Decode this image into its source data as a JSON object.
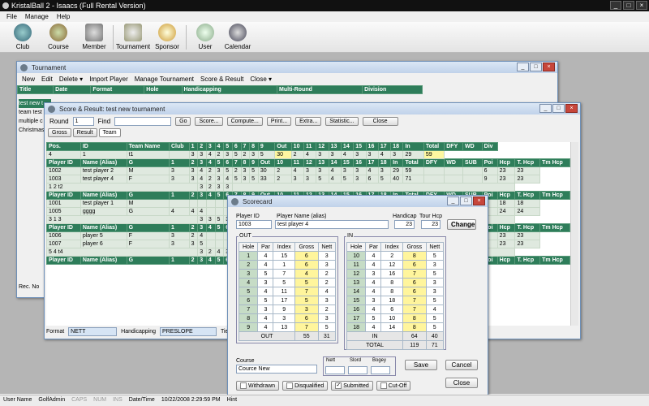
{
  "app": {
    "title": "KristalBall 2 - Isaacs (Full Rental Version)"
  },
  "menu": [
    "File",
    "Manage",
    "Help"
  ],
  "toolbar": [
    "Club",
    "Course",
    "Member",
    "Tournament",
    "Sponsor",
    "User",
    "Calendar"
  ],
  "tourn": {
    "title": "Tournament",
    "tools": [
      "New",
      "Edit",
      "Delete ▾",
      "Import Player",
      "Manage Tournament",
      "Score & Result",
      "Close ▾"
    ],
    "headers": [
      "Title",
      "Date",
      "Format",
      "Hole",
      "Handicapping",
      "Multi-Round",
      "Division"
    ],
    "rows": [
      "test new t",
      "team test",
      "multiple c",
      "Christmas"
    ],
    "rec": "Rec. No"
  },
  "sr": {
    "title": "Score & Result: test new tournament",
    "round_label": "Round",
    "round_val": "1",
    "find_label": "Find",
    "buttons": [
      "Go",
      "Score...",
      "Compute...",
      "Print...",
      "Extra...",
      "Statistic...",
      "Close"
    ],
    "tabs": [
      "Gross",
      "Result",
      "Team"
    ],
    "team_headers": [
      "Pos.",
      "ID",
      "Team Name",
      "Club",
      "1",
      "2",
      "3",
      "4",
      "5",
      "6",
      "7",
      "8",
      "9",
      "Out",
      "10",
      "11",
      "12",
      "13",
      "14",
      "15",
      "16",
      "17",
      "18",
      "In",
      "Total",
      "DFY",
      "WD",
      "Div"
    ],
    "team1": [
      "4",
      "1",
      "t1",
      "",
      "3",
      "3",
      "4",
      "2",
      "3",
      "5",
      "2",
      "3",
      "5",
      "30",
      "2",
      "4",
      "3",
      "3",
      "4",
      "3",
      "3",
      "4",
      "3",
      "29",
      "59"
    ],
    "ph": [
      "Player ID",
      "Name (Alias)",
      "G",
      "1",
      "2",
      "3",
      "4",
      "5",
      "6",
      "7",
      "8",
      "9",
      "Out",
      "10",
      "11",
      "12",
      "13",
      "14",
      "15",
      "16",
      "17",
      "18",
      "In",
      "Total",
      "DFY",
      "WD",
      "SUB",
      "Poi",
      "Hcp",
      "T. Hcp",
      "Tm Hcp"
    ],
    "p1": [
      "1002",
      "test player 2",
      "M",
      "3",
      "3",
      "4",
      "2",
      "3",
      "5",
      "2",
      "3",
      "5",
      "30",
      "2",
      "4",
      "3",
      "3",
      "4",
      "3",
      "3",
      "4",
      "3",
      "29",
      "59",
      "",
      "",
      "",
      "6",
      "23",
      "23"
    ],
    "p2": [
      "1003",
      "test player 4",
      "F",
      "3",
      "3",
      "4",
      "2",
      "3",
      "4",
      "5",
      "3",
      "5",
      "33",
      "2",
      "3",
      "3",
      "5",
      "4",
      "5",
      "3",
      "6",
      "5",
      "40",
      "71",
      "",
      "",
      "",
      "9",
      "23",
      "23"
    ],
    "team2": "1 2 t2",
    "team2vals": [
      "3",
      "2",
      "3",
      "3"
    ],
    "p3": [
      "1001",
      "test player 1",
      "M",
      "",
      "",
      "",
      "",
      "",
      "",
      "",
      "",
      "",
      "",
      "",
      "",
      "",
      "",
      "",
      "",
      "",
      "",
      "",
      "",
      "",
      "",
      "",
      "",
      "1",
      "18",
      "18"
    ],
    "p4": [
      "1005",
      "gggg",
      "G",
      "4",
      "4",
      "4",
      "",
      "",
      "",
      "",
      "",
      "",
      "",
      "",
      "",
      "",
      "",
      "",
      "",
      "",
      "",
      "",
      "",
      "",
      "",
      "",
      "",
      "1",
      "24",
      "24"
    ],
    "team3": "3 1 3",
    "team3vals": [
      "3",
      "3",
      "5",
      "3"
    ],
    "p5": [
      "1006",
      "player 5",
      "F",
      "3",
      "2",
      "4",
      "",
      "",
      "",
      "",
      "",
      "",
      "",
      "",
      "",
      "",
      "",
      "",
      "",
      "",
      "",
      "",
      "",
      "",
      "",
      "",
      "",
      "6",
      "23",
      "23"
    ],
    "p6": [
      "1007",
      "player 6",
      "F",
      "3",
      "3",
      "5",
      "",
      "",
      "",
      "",
      "",
      "",
      "",
      "",
      "",
      "",
      "",
      "",
      "",
      "",
      "",
      "",
      "",
      "",
      "",
      "",
      "",
      "6",
      "23",
      "23"
    ],
    "team4": "5 4 t4",
    "team4vals": [
      "3",
      "2",
      "4",
      "3"
    ],
    "footer": {
      "format_label": "Format",
      "format_val": "NETT",
      "hcp_label": "Handicapping",
      "hcp_val": "PRESLOPE",
      "tie_label": "Tie B"
    }
  },
  "sc": {
    "title": "Scorecard",
    "pid_label": "Player ID",
    "pid": "1003",
    "pname_label": "Player Name (alias)",
    "pname": "test player 4",
    "hcp_label": "Handicap",
    "hcp": "23",
    "thcp_label": "Tour Hcp",
    "thcp": "23",
    "change": "Change",
    "out_label": "OUT",
    "in_label": "IN",
    "cols": [
      "Hole",
      "Par",
      "Index",
      "Gross",
      "Nett"
    ],
    "out": [
      [
        "1",
        "4",
        "15",
        "6",
        "3"
      ],
      [
        "2",
        "4",
        "1",
        "6",
        "3"
      ],
      [
        "3",
        "5",
        "7",
        "4",
        "2"
      ],
      [
        "4",
        "3",
        "5",
        "5",
        "2"
      ],
      [
        "5",
        "4",
        "11",
        "7",
        "4"
      ],
      [
        "6",
        "5",
        "17",
        "5",
        "3"
      ],
      [
        "7",
        "3",
        "9",
        "3",
        "2"
      ],
      [
        "8",
        "4",
        "3",
        "6",
        "3"
      ],
      [
        "9",
        "4",
        "13",
        "7",
        "5"
      ]
    ],
    "out_tot": [
      "OUT",
      "55",
      "31"
    ],
    "in": [
      [
        "10",
        "4",
        "2",
        "8",
        "5"
      ],
      [
        "11",
        "4",
        "12",
        "6",
        "3"
      ],
      [
        "12",
        "3",
        "16",
        "7",
        "5"
      ],
      [
        "13",
        "4",
        "8",
        "6",
        "3"
      ],
      [
        "14",
        "4",
        "8",
        "6",
        "3"
      ],
      [
        "15",
        "3",
        "18",
        "7",
        "5"
      ],
      [
        "16",
        "4",
        "6",
        "7",
        "4"
      ],
      [
        "17",
        "5",
        "10",
        "8",
        "5"
      ],
      [
        "18",
        "4",
        "14",
        "8",
        "5"
      ]
    ],
    "in_tot": [
      "IN",
      "64",
      "40"
    ],
    "total": [
      "TOTAL",
      "119",
      "71"
    ],
    "course_label": "Course",
    "course": "Cource New",
    "stat_labels": [
      "Nett",
      "Slord",
      "Bogey"
    ],
    "save": "Save",
    "cancel": "Cancel",
    "close": "Close",
    "checks": [
      "Withdrawn",
      "Disqualified",
      "Submitted",
      "Cut-Off"
    ]
  },
  "status": {
    "user_label": "User Name",
    "user": "GolfAdmin",
    "caps": "CAPS",
    "num": "NUM",
    "ins": "INS",
    "dt_label": "Date/Time",
    "dt": "10/22/2008 2:29:59 PM",
    "hint": "Hint"
  }
}
